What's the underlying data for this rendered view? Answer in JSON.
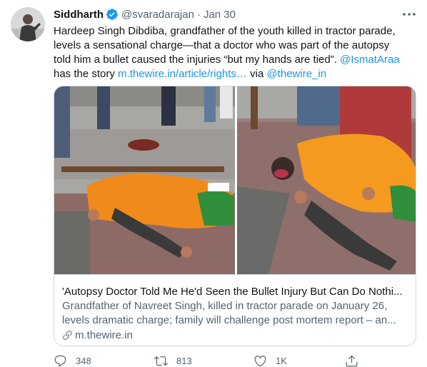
{
  "tweet": {
    "author": {
      "display_name": "Siddharth",
      "handle": "@svaradarajan",
      "verified": true
    },
    "separator": "·",
    "timestamp": "Jan 30",
    "text": {
      "line1": "Hardeep Singh Dibdiba, grandfather of the youth killed in tractor parade,",
      "line2": "levels a sensational charge—that a doctor who was part of the autopsy",
      "line3_text": "told him a bullet caused the injuries “but my hands are tied”. ",
      "line3_mention": "@IsmatAraa",
      "line4_text": "has the story ",
      "line4_link": "m.thewire.in/article/rights…",
      "line4_via": " via ",
      "line4_mention": "@thewire_in"
    },
    "card": {
      "title": "'Autopsy Doctor Told Me He'd Seen the Bullet Injury But Can Do Nothi...",
      "desc_line1": "Grandfather of Navreet Singh, killed in tractor parade on January 26,",
      "desc_line2": "levels dramatic charge; family will challenge post mortem report – an...",
      "domain": "m.thewire.in"
    },
    "actions": {
      "reply_count": "348",
      "retweet_count": "813",
      "like_count": "1K",
      "share_label": ""
    },
    "icons": {
      "verified": "verified-badge-icon",
      "more": "more-dots-icon",
      "link": "link-icon",
      "reply": "reply-icon",
      "retweet": "retweet-icon",
      "like": "heart-icon",
      "share": "share-icon"
    },
    "colors": {
      "link": "#1b95e0",
      "verified": "#1d9bf0",
      "secondary_text": "#536471",
      "border": "#cfd9de"
    }
  }
}
